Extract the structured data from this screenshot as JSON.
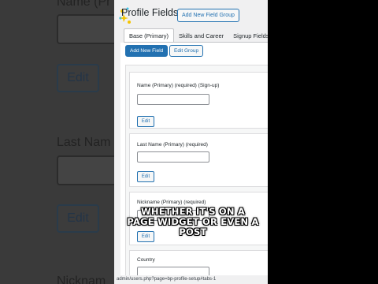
{
  "background_zoom": {
    "label_top": "Name (Pr",
    "label_mid": "Last Nam",
    "label_bottom": "Nicknam",
    "edit_label": "Edit"
  },
  "header": {
    "title": "Profile Fields",
    "add_group_label": "Add New Field Group"
  },
  "tabs": [
    {
      "label": "Base (Primary)",
      "active": true
    },
    {
      "label": "Skills and Career",
      "active": false
    },
    {
      "label": "Signup Fields",
      "active": false
    }
  ],
  "toolbar": {
    "add_field_label": "Add New Field",
    "edit_group_label": "Edit Group"
  },
  "fields": [
    {
      "label": "Name (Primary) (required) (Sign-up)",
      "edit_label": "Edit"
    },
    {
      "label": "Last Name (Primary) (required)",
      "edit_label": "Edit"
    },
    {
      "label": "Nickname (Primary) (required)",
      "edit_label": "Edit"
    },
    {
      "label": "Country",
      "edit_label": ""
    }
  ],
  "url_bar": "admin/users.php?page=bp-profile-setup#tabs-1",
  "caption": "WHETHER IT'S ON A PAGE WIDGET OR EVEN A POST",
  "colors": {
    "wp_blue": "#2271b1",
    "admin_bg": "#f0f0f1"
  }
}
